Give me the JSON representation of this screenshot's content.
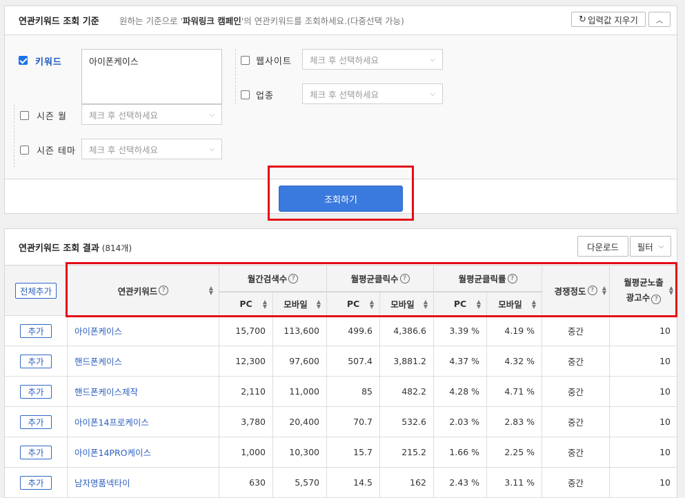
{
  "criteria": {
    "title": "연관키워드 조회 기준",
    "desc_prefix": "원하는 기준으로 '",
    "desc_bold": "파워링크 캠페인",
    "desc_suffix": "'의 연관키워드를 조회하세요.(다중선택 가능)",
    "reset_label": "입력값 지우기",
    "collapse_label": "︿",
    "keyword": {
      "label": "키워드",
      "checked": true,
      "value": "아이폰케이스"
    },
    "website": {
      "label": "웹사이트",
      "checked": false,
      "placeholder": "체크 후 선택하세요"
    },
    "industry": {
      "label": "업종",
      "checked": false,
      "placeholder": "체크 후 선택하세요"
    },
    "season_month": {
      "label": "시즌 월",
      "checked": false,
      "placeholder": "체크 후 선택하세요"
    },
    "season_theme": {
      "label": "시즌 테마",
      "checked": false,
      "placeholder": "체크 후 선택하세요"
    },
    "search_button": "조회하기"
  },
  "results": {
    "title": "연관키워드 조회 결과",
    "count": "(814개)",
    "download_label": "다운로드",
    "filter_label": "필터",
    "add_all_label": "전체추가",
    "add_label": "추가",
    "headers": {
      "keyword": "연관키워드",
      "monthly_search": "월간검색수",
      "monthly_clicks": "월평균클릭수",
      "monthly_ctr": "월평균클릭률",
      "pc": "PC",
      "mobile": "모바일",
      "competition": "경쟁정도",
      "ad_count_line1": "월평균노출",
      "ad_count_line2": "광고수"
    },
    "rows": [
      {
        "keyword": "아이폰케이스",
        "search_pc": "15,700",
        "search_mobile": "113,600",
        "click_pc": "499.6",
        "click_mobile": "4,386.6",
        "ctr_pc": "3.39 %",
        "ctr_mobile": "4.19 %",
        "competition": "중간",
        "ads": "10"
      },
      {
        "keyword": "핸드폰케이스",
        "search_pc": "12,300",
        "search_mobile": "97,600",
        "click_pc": "507.4",
        "click_mobile": "3,881.2",
        "ctr_pc": "4.37 %",
        "ctr_mobile": "4.32 %",
        "competition": "중간",
        "ads": "10"
      },
      {
        "keyword": "핸드폰케이스제작",
        "search_pc": "2,110",
        "search_mobile": "11,000",
        "click_pc": "85",
        "click_mobile": "482.2",
        "ctr_pc": "4.28 %",
        "ctr_mobile": "4.71 %",
        "competition": "중간",
        "ads": "10"
      },
      {
        "keyword": "아이폰14프로케이스",
        "search_pc": "3,780",
        "search_mobile": "20,400",
        "click_pc": "70.7",
        "click_mobile": "532.6",
        "ctr_pc": "2.03 %",
        "ctr_mobile": "2.83 %",
        "competition": "중간",
        "ads": "10"
      },
      {
        "keyword": "아이폰14PRO케이스",
        "search_pc": "1,000",
        "search_mobile": "10,300",
        "click_pc": "15.7",
        "click_mobile": "215.2",
        "ctr_pc": "1.66 %",
        "ctr_mobile": "2.25 %",
        "competition": "중간",
        "ads": "10"
      },
      {
        "keyword": "남자명품넥타이",
        "search_pc": "630",
        "search_mobile": "5,570",
        "click_pc": "14.5",
        "click_mobile": "162",
        "ctr_pc": "2.43 %",
        "ctr_mobile": "3.11 %",
        "competition": "중간",
        "ads": "10"
      }
    ]
  },
  "colors": {
    "accent": "#3a79dd",
    "highlight": "#e30b17",
    "link": "#2a5ebf"
  }
}
